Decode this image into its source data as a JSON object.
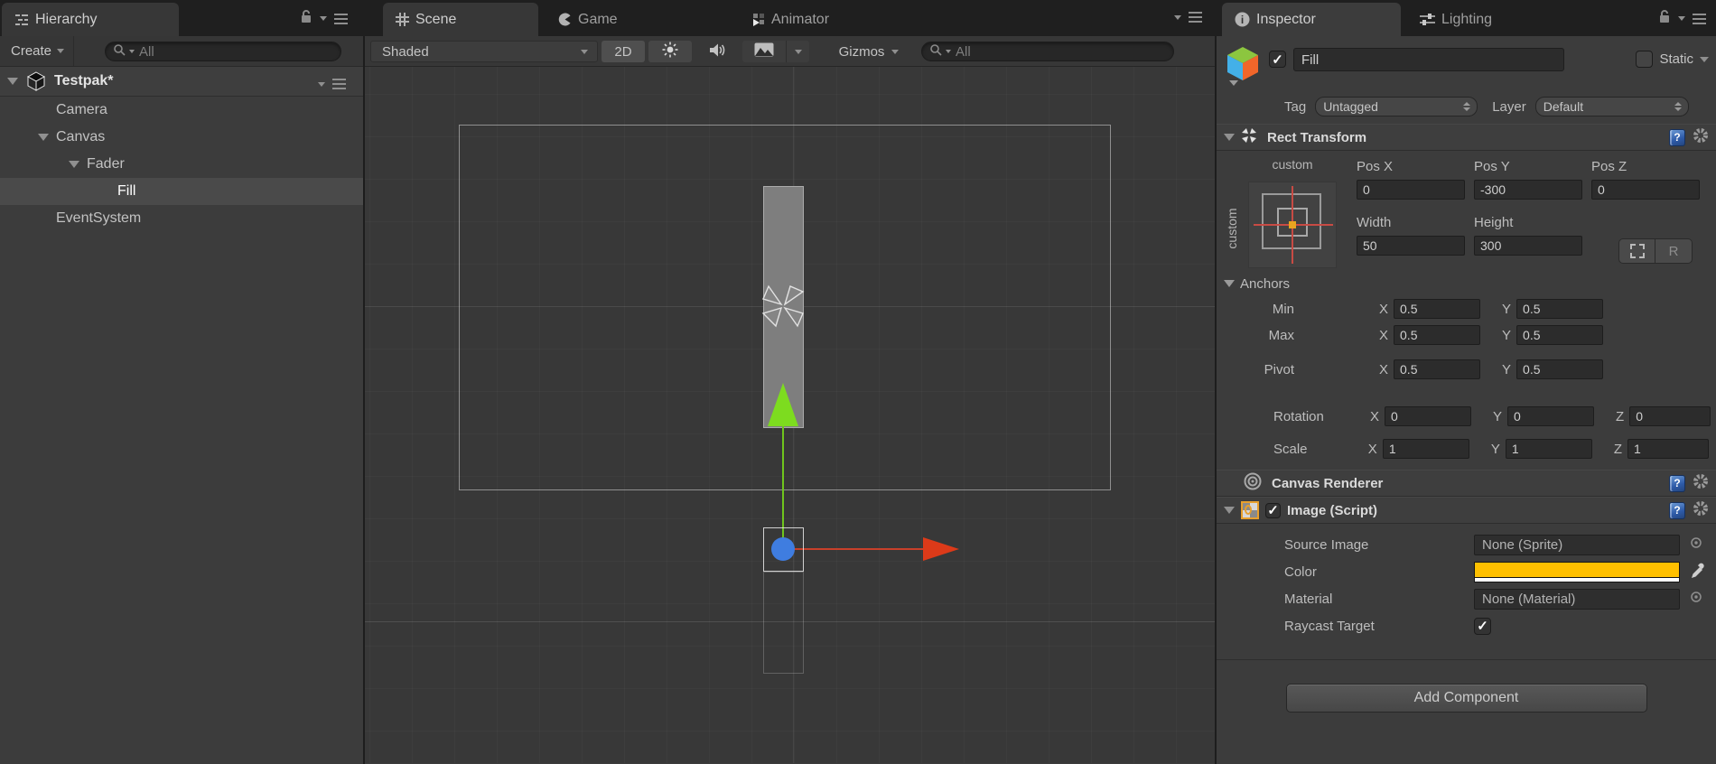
{
  "tabs": {
    "hierarchy": "Hierarchy",
    "scene": "Scene",
    "game": "Game",
    "animator": "Animator",
    "inspector": "Inspector",
    "lighting": "Lighting"
  },
  "hierarchy": {
    "create_label": "Create",
    "search_placeholder": "All",
    "scene_name": "Testpak*",
    "items": [
      {
        "label": "Camera"
      },
      {
        "label": "Canvas"
      },
      {
        "label": "Fader"
      },
      {
        "label": "Fill"
      },
      {
        "label": "EventSystem"
      }
    ]
  },
  "scene_toolbar": {
    "shaded_label": "Shaded",
    "mode_2d_label": "2D",
    "gizmos_label": "Gizmos",
    "search_placeholder": "All"
  },
  "inspector": {
    "name": "Fill",
    "static_label": "Static",
    "tag_label": "Tag",
    "tag_value": "Untagged",
    "layer_label": "Layer",
    "layer_value": "Default",
    "rect_transform": {
      "title": "Rect Transform",
      "anchor_preset": "custom",
      "anchor_preset_side": "custom",
      "axis": {
        "x": "X",
        "y": "Y",
        "z": "Z"
      },
      "pos": {
        "x_label": "Pos X",
        "y_label": "Pos Y",
        "z_label": "Pos Z",
        "x": "0",
        "y": "-300",
        "z": "0"
      },
      "size": {
        "w_label": "Width",
        "h_label": "Height",
        "w": "50",
        "h": "300"
      },
      "raw_button": "R",
      "anchors_label": "Anchors",
      "min": {
        "label": "Min",
        "x": "0.5",
        "y": "0.5"
      },
      "max": {
        "label": "Max",
        "x": "0.5",
        "y": "0.5"
      },
      "pivot": {
        "label": "Pivot",
        "x": "0.5",
        "y": "0.5"
      },
      "rotation": {
        "label": "Rotation",
        "x": "0",
        "y": "0",
        "z": "0"
      },
      "scale": {
        "label": "Scale",
        "x": "1",
        "y": "1",
        "z": "1"
      }
    },
    "canvas_renderer": {
      "title": "Canvas Renderer"
    },
    "image": {
      "title": "Image (Script)",
      "source_image_label": "Source Image",
      "source_image_value": "None (Sprite)",
      "color_label": "Color",
      "color_value": "#ffc000",
      "material_label": "Material",
      "material_value": "None (Material)",
      "raycast_label": "Raycast Target"
    },
    "add_component": "Add Component"
  }
}
